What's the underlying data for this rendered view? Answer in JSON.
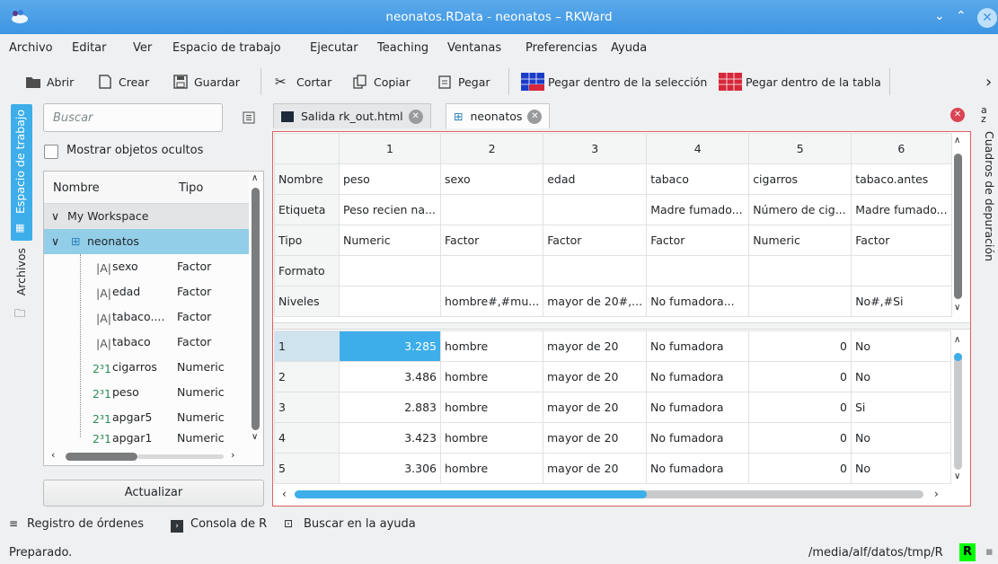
{
  "window": {
    "title": "neonatos.RData - neonatos – RKWard"
  },
  "menu": [
    "Archivo",
    "Editar",
    "Ver",
    "Espacio de trabajo",
    "Ejecutar",
    "Teaching",
    "Ventanas",
    "Preferencias",
    "Ayuda"
  ],
  "toolbar": {
    "open": "Abrir",
    "create": "Crear",
    "save": "Guardar",
    "cut": "Cortar",
    "copy": "Copiar",
    "paste": "Pegar",
    "paste_sel": "Pegar dentro de la selección",
    "paste_table": "Pegar dentro de la tabla",
    "more": "›"
  },
  "left_tabs": {
    "workspace": "Espacio de trabajo",
    "files": "Archivos"
  },
  "right_tab": "Cuadros de depuración",
  "workspace": {
    "search_placeholder": "Buscar",
    "show_hidden": "Mostrar objetos ocultos",
    "col_name": "Nombre",
    "col_type": "Tipo",
    "root": "My Workspace",
    "dataset": "neonatos",
    "vars": [
      {
        "name": "sexo",
        "type": "Factor",
        "icon": "factor"
      },
      {
        "name": "edad",
        "type": "Factor",
        "icon": "factor"
      },
      {
        "name": "tabaco....",
        "type": "Factor",
        "icon": "factor"
      },
      {
        "name": "tabaco",
        "type": "Factor",
        "icon": "factor"
      },
      {
        "name": "cigarros",
        "type": "Numeric",
        "icon": "numeric"
      },
      {
        "name": "peso",
        "type": "Numeric",
        "icon": "numeric"
      },
      {
        "name": "apgar5",
        "type": "Numeric",
        "icon": "numeric"
      },
      {
        "name": "apgar1",
        "type": "Numeric",
        "icon": "numeric"
      }
    ],
    "update": "Actualizar"
  },
  "tabs": [
    {
      "label": "Salida rk_out.html"
    },
    {
      "label": "neonatos"
    }
  ],
  "grid": {
    "col_numbers": [
      "1",
      "2",
      "3",
      "4",
      "5",
      "6"
    ],
    "meta": [
      {
        "label": "Nombre",
        "cells": [
          "peso",
          "sexo",
          "edad",
          "tabaco",
          "cigarros",
          "tabaco.antes"
        ]
      },
      {
        "label": "Etiqueta",
        "cells": [
          "Peso recien na...",
          "",
          "",
          "Madre fumado...",
          "Número de cig...",
          "Madre fumado..."
        ]
      },
      {
        "label": "Tipo",
        "cells": [
          "Numeric",
          "Factor",
          "Factor",
          "Factor",
          "Numeric",
          "Factor"
        ]
      },
      {
        "label": "Formato",
        "cells": [
          "",
          "",
          "",
          "",
          "",
          ""
        ]
      },
      {
        "label": "Niveles",
        "cells": [
          "",
          "hombre#,#mu...",
          "mayor de 20#,...",
          "No fumadora...",
          "",
          "No#,#Si"
        ]
      }
    ],
    "rows": [
      {
        "n": "1",
        "cells": [
          "3.285",
          "hombre",
          "mayor de 20",
          "No fumadora",
          "0",
          "No"
        ]
      },
      {
        "n": "2",
        "cells": [
          "3.486",
          "hombre",
          "mayor de 20",
          "No fumadora",
          "0",
          "No"
        ]
      },
      {
        "n": "3",
        "cells": [
          "2.883",
          "hombre",
          "mayor de 20",
          "No fumadora",
          "0",
          "Si"
        ]
      },
      {
        "n": "4",
        "cells": [
          "3.423",
          "hombre",
          "mayor de 20",
          "No fumadora",
          "0",
          "No"
        ]
      },
      {
        "n": "5",
        "cells": [
          "3.306",
          "hombre",
          "mayor de 20",
          "No fumadora",
          "0",
          "No"
        ]
      }
    ]
  },
  "bottom": {
    "log": "Registro de órdenes",
    "console": "Consola de R",
    "help": "Buscar en la ayuda"
  },
  "status": {
    "text": "Preparado.",
    "path": "/media/alf/datos/tmp/R",
    "r_badge": "R"
  },
  "colors": {
    "accent": "#3daee9",
    "title": "#3d95e2",
    "close": "#da4453",
    "r_badge": "#00ff00"
  }
}
